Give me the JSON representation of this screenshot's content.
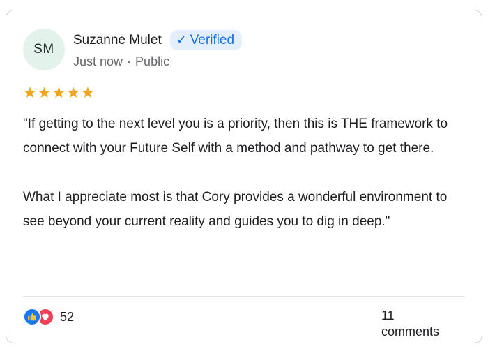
{
  "author": {
    "initials": "SM",
    "name": "Suzanne Mulet",
    "verified_label": "Verified",
    "time": "Just now",
    "separator": "·",
    "visibility": "Public"
  },
  "rating": {
    "value": 5,
    "max": 5,
    "color": "#f0a51e"
  },
  "review": {
    "paragraphs": [
      "\"If getting to the next level you is a priority, then this is THE framework to connect with your Future Self with a method and pathway to get there.",
      "What I appreciate most is that Cory provides a wonderful environment to see beyond your current reality and guides you to dig in deep.\""
    ]
  },
  "engagement": {
    "reaction_icons": [
      "like-icon",
      "heart-icon"
    ],
    "reaction_count": "52",
    "comments_count": "11",
    "comments_label": "comments"
  },
  "colors": {
    "avatar_bg": "#e3f3ec",
    "verified_bg": "#e4effd",
    "verified_text": "#1a6fe0",
    "like": "#1877f2",
    "heart": "#f33e58"
  }
}
